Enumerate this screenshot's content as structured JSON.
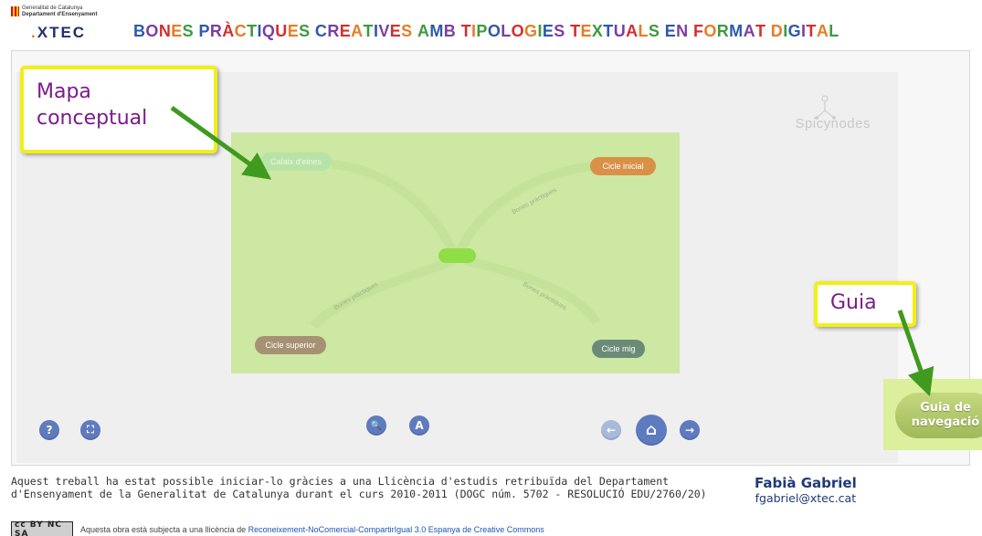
{
  "header": {
    "gencat_line1": "Generalitat de Catalunya",
    "gencat_line2": "Departament d'Ensenyament",
    "xtec_dot": ".",
    "xtec_text": "XTEC",
    "banner_title": "BONES PRÀCTIQUES CREATIVES AMB TIPOLOGIES TEXTUALS EN FORMAT DIGITAL"
  },
  "colors": {
    "banner_blue": "#2e5aa8",
    "banner_purple": "#7b3fa0",
    "banner_red": "#d32f2f",
    "banner_orange": "#e57d27",
    "banner_green": "#3f9a3f",
    "callout_border": "#f2ef17",
    "callout_text": "#7a1c8a",
    "arrow_green": "#3f9a1e"
  },
  "spicynodes": {
    "logo_text": "Spicynodes"
  },
  "map": {
    "nodes": {
      "eines": "Calaix d'eines",
      "inicial": "Cicle inicial",
      "superior": "Cicle superior",
      "mig": "Cicle mig"
    },
    "edge_label": "Bones pràctiques"
  },
  "callouts": {
    "mapa": "Mapa conceptual",
    "guia": "Guia"
  },
  "controls": {
    "help": "?",
    "fullscreen": "⛶",
    "zoom": "🔍",
    "font": "A",
    "back": "←",
    "home": "⌂",
    "forward": "→"
  },
  "guide_button": {
    "line1": "Guia de",
    "line2": "navegació"
  },
  "footer": {
    "credit": "Aquest treball ha estat possible iniciar-lo gràcies a una Llicència d'estudis retribuïda del Departament d'Ensenyament de la Generalitat de Catalunya durant el curs 2010-2011 (DOGC núm. 5702 - RESOLUCIÓ EDU/2760/20)",
    "author_name": "Fabià Gabriel",
    "author_email": "fgabriel@xtec.cat",
    "cc_badge": "cc BY NC SA",
    "license_prefix": "Aquesta obra està subjecta a una llicència de ",
    "license_link": "Reconeixement-NoComercial-CompartirIgual 3.0 Espanya de Creative Commons"
  }
}
